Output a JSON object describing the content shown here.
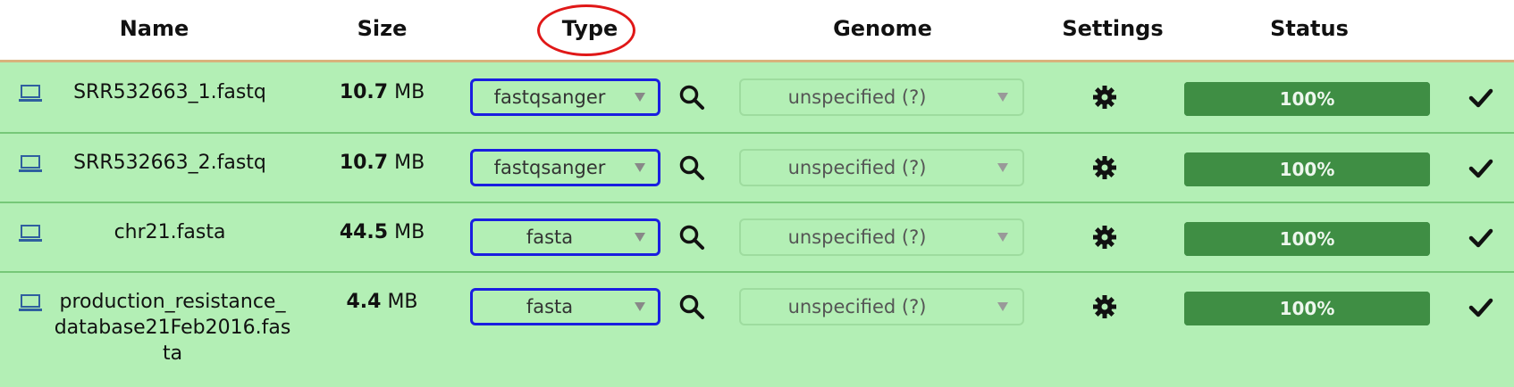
{
  "headers": {
    "name": "Name",
    "size": "Size",
    "type": "Type",
    "genome": "Genome",
    "settings": "Settings",
    "status": "Status"
  },
  "rows": [
    {
      "name": "SRR532663_1.fastq",
      "size_num": "10.7",
      "size_unit": " MB",
      "type": "fastqsanger",
      "genome": "unspecified (?)",
      "status": "100%",
      "progress": 1.0
    },
    {
      "name": "SRR532663_2.fastq",
      "size_num": "10.7",
      "size_unit": " MB",
      "type": "fastqsanger",
      "genome": "unspecified (?)",
      "status": "100%",
      "progress": 1.0
    },
    {
      "name": "chr21.fasta",
      "size_num": "44.5",
      "size_unit": " MB",
      "type": "fasta",
      "genome": "unspecified (?)",
      "status": "100%",
      "progress": 1.0
    },
    {
      "name_lines": [
        "production_resistance_",
        "database21Feb2016.fas",
        "ta"
      ],
      "size_num": "4.4",
      "size_unit": " MB",
      "type": "fasta",
      "genome": "unspecified (?)",
      "status": "100%",
      "progress": 1.0
    }
  ],
  "icons": {
    "upload_source": "laptop-icon",
    "preview": "search-icon",
    "settings": "gear-icon",
    "done": "checkmark-icon",
    "dropdown": "chevron-down-icon"
  },
  "colors": {
    "row_bg": "#b3efb5",
    "row_border": "#76c878",
    "progress": "#3f8e44",
    "type_highlight": "#1a1ee0",
    "annotation_circle": "#e01818",
    "header_border": "#d9b27c"
  }
}
